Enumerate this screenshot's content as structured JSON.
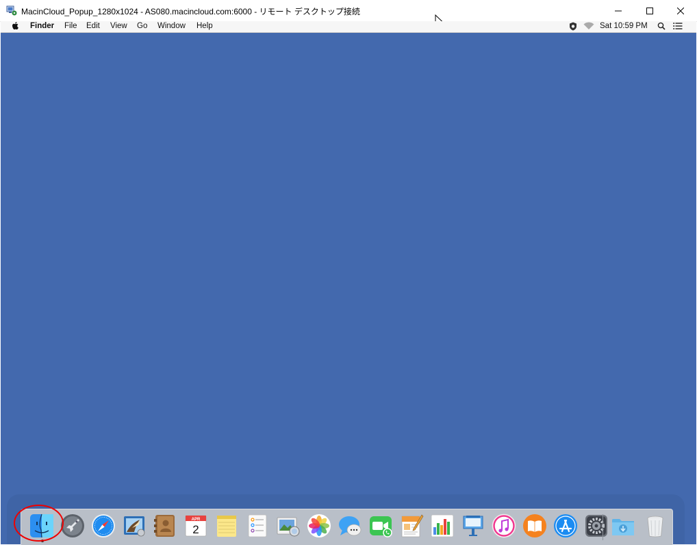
{
  "window": {
    "title": "MacinCloud_Popup_1280x1024 - AS080.macincloud.com:6000 - リモート デスクトップ接続",
    "app_icon": "remote-desktop-icon",
    "controls": [
      "minimize-icon",
      "maximize-icon",
      "close-icon"
    ]
  },
  "menubar": {
    "apple_icon": "apple-logo-icon",
    "items": [
      "Finder",
      "File",
      "Edit",
      "View",
      "Go",
      "Window",
      "Help"
    ],
    "status": {
      "icons": [
        "security-shield-icon",
        "wifi-icon"
      ],
      "clock": "Sat 10:59 PM",
      "right_icons": [
        "spotlight-search-icon",
        "notification-center-icon"
      ]
    }
  },
  "desktop": {
    "background_color": "#4369ae"
  },
  "dock": {
    "items": [
      {
        "name": "finder",
        "icon": "finder-icon",
        "running": true
      },
      {
        "name": "launchpad",
        "icon": "launchpad-icon"
      },
      {
        "name": "safari",
        "icon": "safari-icon"
      },
      {
        "name": "mail",
        "icon": "mail-icon"
      },
      {
        "name": "contacts",
        "icon": "contacts-icon"
      },
      {
        "name": "calendar",
        "icon": "calendar-icon",
        "month": "APR",
        "day": "2"
      },
      {
        "name": "notes",
        "icon": "notes-icon"
      },
      {
        "name": "reminders",
        "icon": "reminders-icon"
      },
      {
        "name": "preview",
        "icon": "preview-icon"
      },
      {
        "name": "photos",
        "icon": "photos-icon"
      },
      {
        "name": "messages",
        "icon": "messages-icon"
      },
      {
        "name": "facetime",
        "icon": "facetime-icon"
      },
      {
        "name": "pages",
        "icon": "pages-icon"
      },
      {
        "name": "numbers",
        "icon": "numbers-icon"
      },
      {
        "name": "keynote",
        "icon": "keynote-icon"
      },
      {
        "name": "itunes",
        "icon": "itunes-icon"
      },
      {
        "name": "ibooks",
        "icon": "ibooks-icon"
      },
      {
        "name": "app-store",
        "icon": "app-store-icon"
      },
      {
        "name": "system-preferences",
        "icon": "system-preferences-icon"
      },
      {
        "name": "downloads",
        "icon": "downloads-folder-icon"
      },
      {
        "name": "trash",
        "icon": "trash-icon"
      }
    ]
  },
  "annotation": {
    "type": "highlight-circle",
    "color": "#e00000",
    "target": "finder"
  },
  "colors": {
    "menubar": "#f6f6f6",
    "dock": "#b9bfc8",
    "highlight": "#e00000"
  }
}
